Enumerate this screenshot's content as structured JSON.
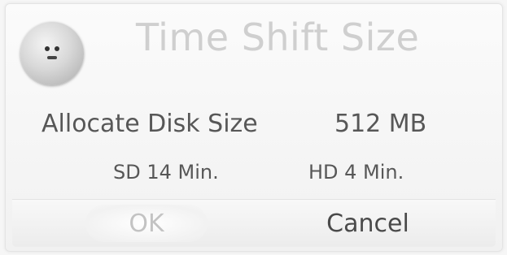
{
  "dialog": {
    "title": "Time Shift Size",
    "allocate_label": "Allocate Disk Size",
    "allocate_value": "512 MB",
    "sd_value": "SD 14 Min.",
    "hd_value": "HD 4 Min.",
    "buttons": {
      "ok_label": "OK",
      "cancel_label": "Cancel"
    }
  },
  "icons": {
    "avatar": "face-icon"
  },
  "colors": {
    "title": "#cfcfcf",
    "text": "#575757",
    "ok_disabled": "#c3c3c3",
    "cancel": "#4a4a4a"
  }
}
